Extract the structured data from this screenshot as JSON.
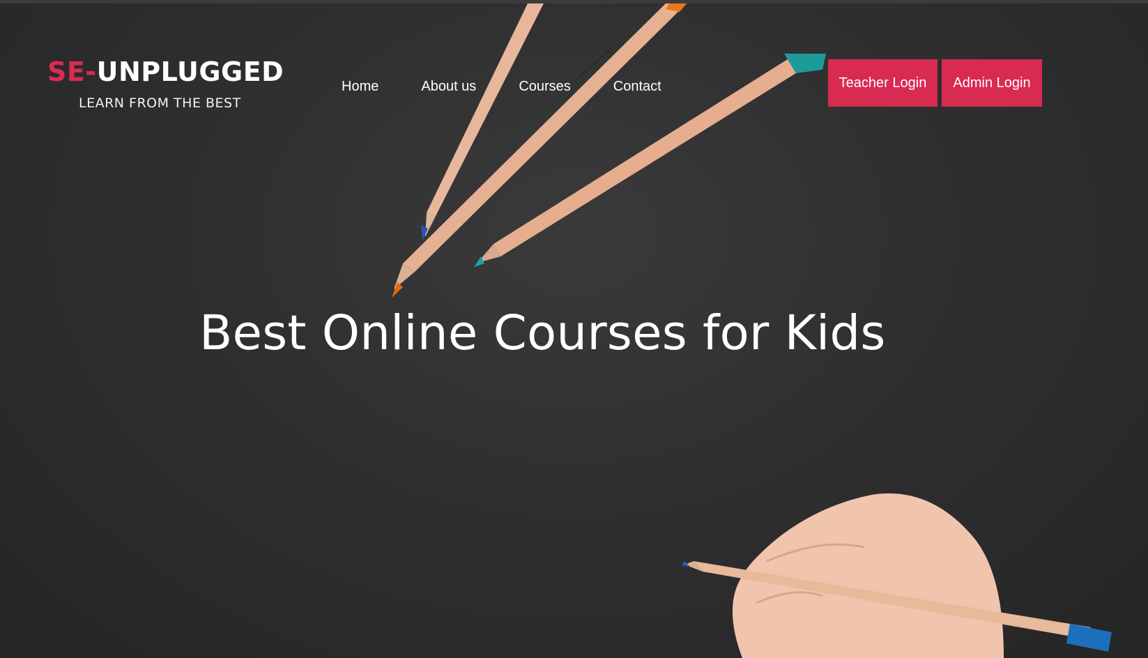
{
  "brand": {
    "prefix": "SE-",
    "name": "UNPLUGGED",
    "tagline": "LEARN FROM THE BEST",
    "accent_color": "#db2b52"
  },
  "nav": {
    "items": [
      {
        "label": "Home"
      },
      {
        "label": "About us"
      },
      {
        "label": "Courses"
      },
      {
        "label": "Contact"
      }
    ]
  },
  "auth": {
    "teacher_label": "Teacher Login",
    "admin_label": "Admin Login",
    "button_color": "#d92a52"
  },
  "hero": {
    "headline": "Best Online Courses for Kids"
  },
  "icons": {
    "background_image": "pencils-and-hand-photo"
  }
}
